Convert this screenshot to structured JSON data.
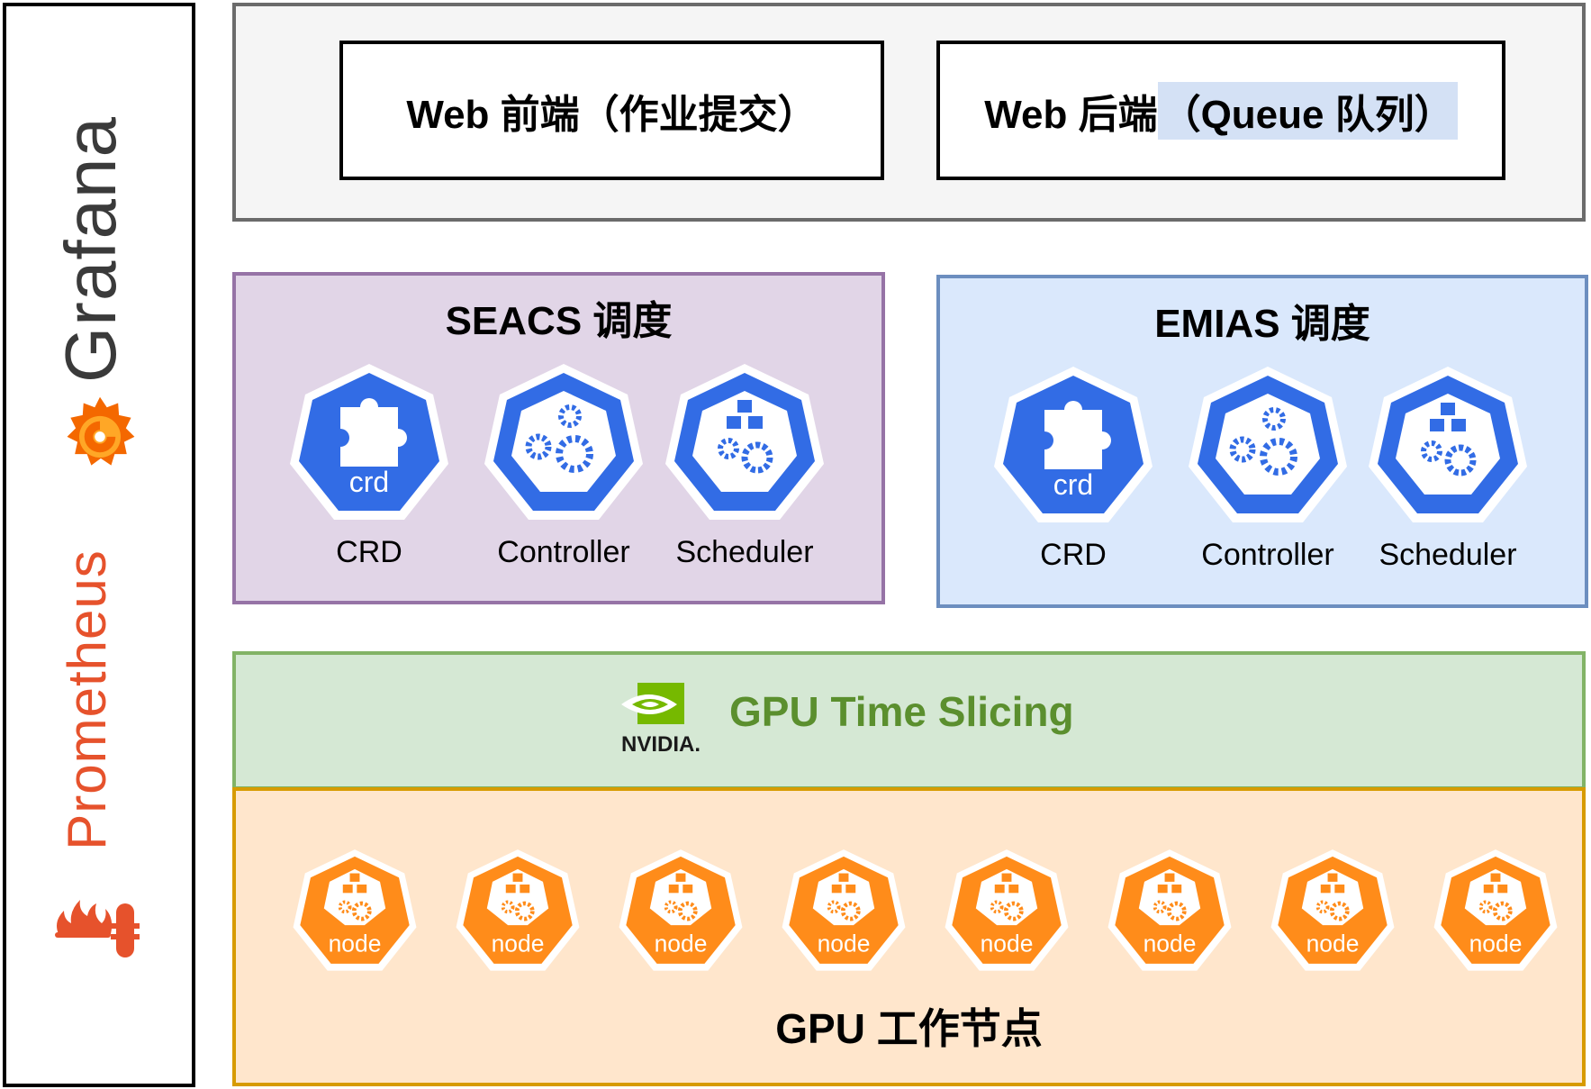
{
  "monitoring": {
    "grafana_label": "Grafana",
    "prometheus_label": "Prometheus",
    "nvidia_logo_text": "NVIDIA."
  },
  "web": {
    "frontend_label": "Web 前端（作业提交）",
    "backend_prefix": "Web 后端",
    "backend_highlight": "（Queue 队列）"
  },
  "schedulers": [
    {
      "title": "SEACS 调度",
      "components": [
        {
          "label": "CRD",
          "icon": "crd-icon",
          "icon_text": "crd"
        },
        {
          "label": "Controller",
          "icon": "controller-icon"
        },
        {
          "label": "Scheduler",
          "icon": "scheduler-icon"
        }
      ]
    },
    {
      "title": "EMIAS 调度",
      "components": [
        {
          "label": "CRD",
          "icon": "crd-icon",
          "icon_text": "crd"
        },
        {
          "label": "Controller",
          "icon": "controller-icon"
        },
        {
          "label": "Scheduler",
          "icon": "scheduler-icon"
        }
      ]
    }
  ],
  "gpu_slicing": {
    "label": "GPU Time Slicing"
  },
  "gpu_nodes": {
    "title": "GPU 工作节点",
    "nodes": [
      "node",
      "node",
      "node",
      "node",
      "node",
      "node",
      "node",
      "node"
    ]
  },
  "colors": {
    "k8s_blue": "#326ce5",
    "node_orange": "#ff8c1a",
    "grafana_orange": "#f46800",
    "prometheus_orange": "#e6522c",
    "nvidia_green": "#76b900",
    "seacs_fill": "#e1d5e7",
    "emias_fill": "#dae8fc",
    "slicing_fill": "#d5e8d4",
    "nodes_fill": "#ffe6cc"
  }
}
